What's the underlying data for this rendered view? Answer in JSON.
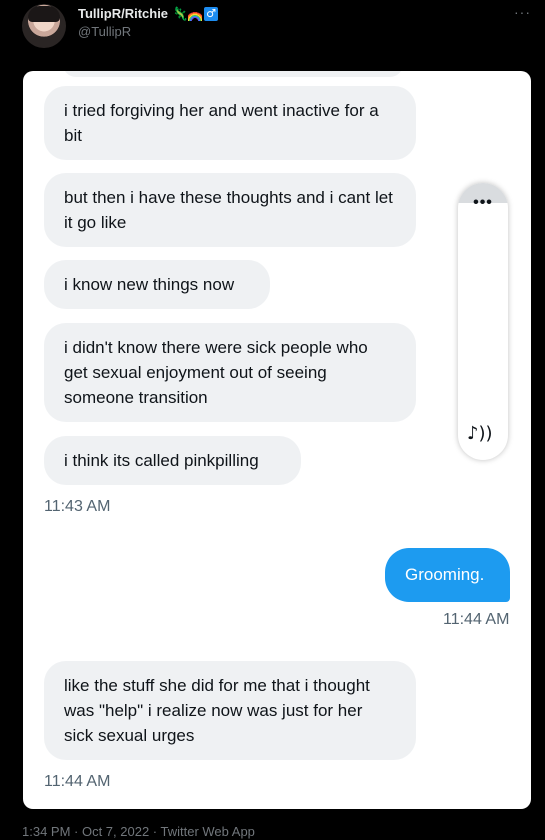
{
  "user": {
    "display_name": "TullipR/Ritchie",
    "handle": "@TullipR",
    "emoji_icons": [
      "lizard-icon",
      "rainbow-icon",
      "male-sign-icon"
    ]
  },
  "header": {
    "more_label": "···"
  },
  "conversation": {
    "messages": [
      {
        "text": "i tried forgiving her and went inactive for a bit"
      },
      {
        "text": "but then i have these thoughts and i cant let it go like"
      },
      {
        "text": "i know new things now"
      },
      {
        "text": "i didn't know there were sick people who get sexual enjoyment out of seeing someone transition"
      },
      {
        "text": "i think its called pinkpilling"
      }
    ],
    "time_1": "11:43 AM",
    "sent_message": "Grooming.",
    "time_2": "11:44 AM",
    "last_message": "like the stuff she did for me that i thought was \"help\" i realize now was just for her sick sexual urges",
    "time_3": "11:44 AM"
  },
  "side_panel": {
    "dots": "•••",
    "icons": [
      "more-icon",
      "speaker-icon"
    ]
  },
  "footer": {
    "meta": "1:34 PM · Oct 7, 2022 · Twitter Web App"
  },
  "colors": {
    "background": "#000000",
    "sent_bubble": "#1d9bf0",
    "received_bubble": "#eff1f3",
    "card": "#ffffff"
  }
}
